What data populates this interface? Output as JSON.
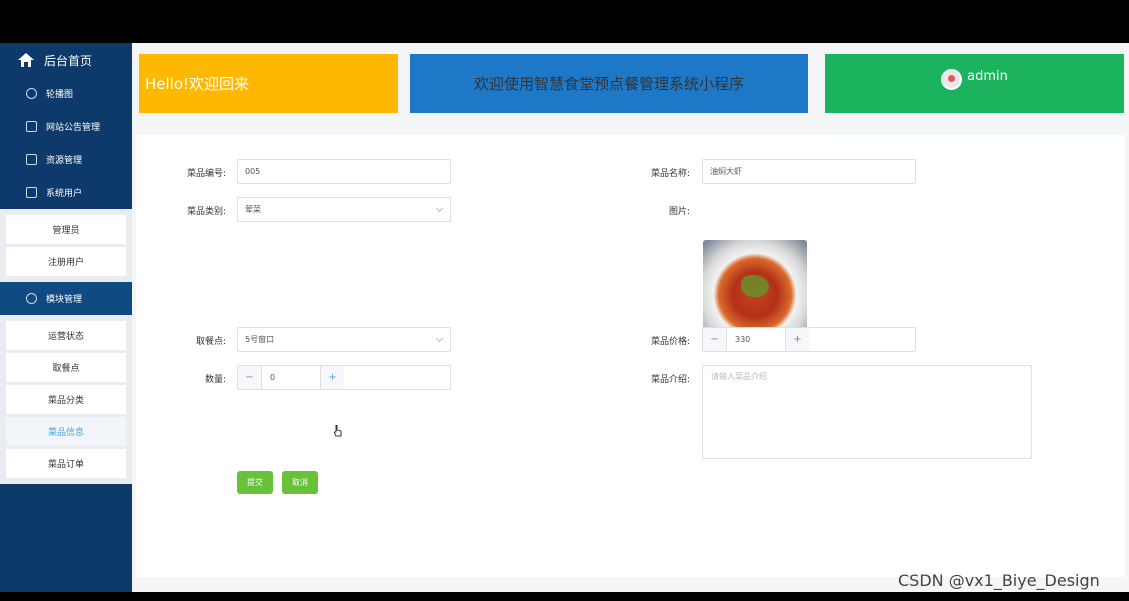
{
  "sidebar": {
    "home_label": "后台首页",
    "groups": [
      {
        "label": "轮播图"
      },
      {
        "label": "网站公告管理"
      },
      {
        "label": "资源管理"
      },
      {
        "label": "系统用户"
      }
    ],
    "user_subs": [
      "管理员",
      "注册用户"
    ],
    "module_group": "模块管理",
    "module_subs": [
      "运营状态",
      "取餐点",
      "菜品分类",
      "菜品信息",
      "菜品订单"
    ],
    "active_item": "菜品信息"
  },
  "header": {
    "hello": "Hello!欢迎回来",
    "welcome": "欢迎使用智慧食堂预点餐管理系统小程序",
    "username": "admin",
    "colors": {
      "hello": "#ffb800",
      "welcome": "#1e78c8",
      "user": "#1bb35e"
    }
  },
  "form": {
    "dish_no_label": "菜品编号:",
    "dish_no_value": "005",
    "dish_name_label": "菜品名称:",
    "dish_name_value": "油焖大虾",
    "category_label": "菜品类别:",
    "category_value": "荤菜",
    "image_label": "图片:",
    "pickup_label": "取餐点:",
    "pickup_value": "5号窗口",
    "price_label": "菜品价格:",
    "price_value": "330",
    "quantity_label": "数量:",
    "quantity_value": "0",
    "intro_label": "菜品介绍:",
    "intro_placeholder": "请输入菜品介绍",
    "submit_label": "提交",
    "cancel_label": "取消",
    "button_color": "#67c23a"
  },
  "watermark": "CSDN @vx1_Biye_Design"
}
